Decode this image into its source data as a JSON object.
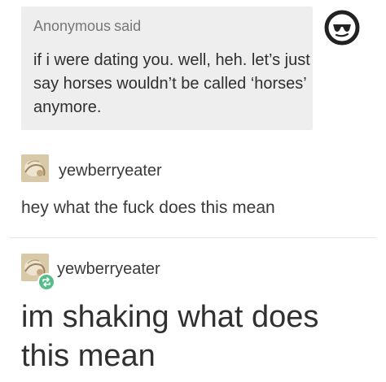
{
  "ask": {
    "author": "Anonymous",
    "said": "said",
    "body": "if i were dating you. well, heh. let’s just say horses wouldn’t be called ‘horses’ anymore."
  },
  "anon_avatar_icon": "sunglasses-icon",
  "replies": [
    {
      "username": "yewberryeater",
      "text": "hey what the fuck does this mean",
      "avatar_icon": "user-avatar"
    },
    {
      "username": "yewberryeater",
      "text": "im shaking what does this mean",
      "avatar_icon": "user-avatar",
      "badge_icon": "reblog-icon"
    }
  ],
  "colors": {
    "bubble": "#eeeeee",
    "reblog_green": "#56bc8a"
  }
}
